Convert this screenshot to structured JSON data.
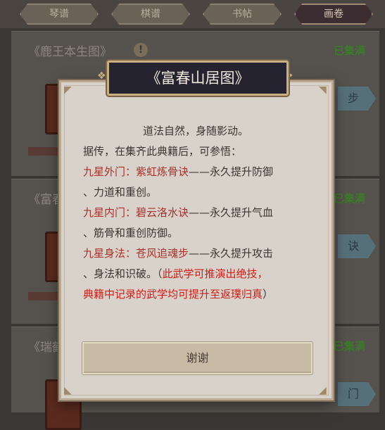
{
  "tabs": [
    {
      "label": "琴谱",
      "active": false
    },
    {
      "label": "棋谱",
      "active": false
    },
    {
      "label": "书帖",
      "active": false
    },
    {
      "label": "画卷",
      "active": true
    }
  ],
  "rows": [
    {
      "title": "《鹿王本生图》",
      "status": "已集满",
      "side_button": "步"
    },
    {
      "title": "《富春",
      "status": "已集满",
      "side_button": "诀"
    },
    {
      "title": "《瑞鹤",
      "status": "已集满",
      "side_button": "门"
    }
  ],
  "modal": {
    "title": "《富春山居图》",
    "intro_1": "道法自然，身随影动。",
    "intro_2": "据传，在集齐此典籍后，可参悟：",
    "skill_1_name": "九星外门：紫虹炼骨诀",
    "skill_1_desc_a": "——永久提升防御",
    "skill_1_desc_b": "、力道和重创。",
    "skill_2_name": "九星内门：碧云洛水诀",
    "skill_2_desc_a": "——永久提升气血",
    "skill_2_desc_b": "、筋骨和重创防御。",
    "skill_3_name": "九星身法：苍风追魂步",
    "skill_3_desc_a": "——永久提升攻击",
    "skill_3_desc_b": "、身法和识破。（",
    "note_a": "此武学可推演出绝技，",
    "note_b": "典籍中记录的武学均可提升至返璞归真",
    "note_close": "）",
    "button_label": "谢谢"
  },
  "colors": {
    "skill_name": "#a8302a",
    "note": "#d11a14",
    "status_green": "#3d7a2b"
  }
}
